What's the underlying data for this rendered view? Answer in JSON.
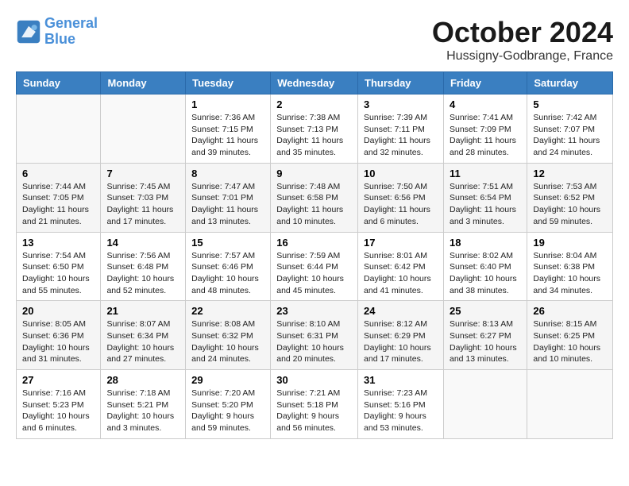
{
  "header": {
    "logo_line1": "General",
    "logo_line2": "Blue",
    "month": "October 2024",
    "location": "Hussigny-Godbrange, France"
  },
  "weekdays": [
    "Sunday",
    "Monday",
    "Tuesday",
    "Wednesday",
    "Thursday",
    "Friday",
    "Saturday"
  ],
  "weeks": [
    [
      {
        "day": "",
        "info": ""
      },
      {
        "day": "",
        "info": ""
      },
      {
        "day": "1",
        "info": "Sunrise: 7:36 AM\nSunset: 7:15 PM\nDaylight: 11 hours and 39 minutes."
      },
      {
        "day": "2",
        "info": "Sunrise: 7:38 AM\nSunset: 7:13 PM\nDaylight: 11 hours and 35 minutes."
      },
      {
        "day": "3",
        "info": "Sunrise: 7:39 AM\nSunset: 7:11 PM\nDaylight: 11 hours and 32 minutes."
      },
      {
        "day": "4",
        "info": "Sunrise: 7:41 AM\nSunset: 7:09 PM\nDaylight: 11 hours and 28 minutes."
      },
      {
        "day": "5",
        "info": "Sunrise: 7:42 AM\nSunset: 7:07 PM\nDaylight: 11 hours and 24 minutes."
      }
    ],
    [
      {
        "day": "6",
        "info": "Sunrise: 7:44 AM\nSunset: 7:05 PM\nDaylight: 11 hours and 21 minutes."
      },
      {
        "day": "7",
        "info": "Sunrise: 7:45 AM\nSunset: 7:03 PM\nDaylight: 11 hours and 17 minutes."
      },
      {
        "day": "8",
        "info": "Sunrise: 7:47 AM\nSunset: 7:01 PM\nDaylight: 11 hours and 13 minutes."
      },
      {
        "day": "9",
        "info": "Sunrise: 7:48 AM\nSunset: 6:58 PM\nDaylight: 11 hours and 10 minutes."
      },
      {
        "day": "10",
        "info": "Sunrise: 7:50 AM\nSunset: 6:56 PM\nDaylight: 11 hours and 6 minutes."
      },
      {
        "day": "11",
        "info": "Sunrise: 7:51 AM\nSunset: 6:54 PM\nDaylight: 11 hours and 3 minutes."
      },
      {
        "day": "12",
        "info": "Sunrise: 7:53 AM\nSunset: 6:52 PM\nDaylight: 10 hours and 59 minutes."
      }
    ],
    [
      {
        "day": "13",
        "info": "Sunrise: 7:54 AM\nSunset: 6:50 PM\nDaylight: 10 hours and 55 minutes."
      },
      {
        "day": "14",
        "info": "Sunrise: 7:56 AM\nSunset: 6:48 PM\nDaylight: 10 hours and 52 minutes."
      },
      {
        "day": "15",
        "info": "Sunrise: 7:57 AM\nSunset: 6:46 PM\nDaylight: 10 hours and 48 minutes."
      },
      {
        "day": "16",
        "info": "Sunrise: 7:59 AM\nSunset: 6:44 PM\nDaylight: 10 hours and 45 minutes."
      },
      {
        "day": "17",
        "info": "Sunrise: 8:01 AM\nSunset: 6:42 PM\nDaylight: 10 hours and 41 minutes."
      },
      {
        "day": "18",
        "info": "Sunrise: 8:02 AM\nSunset: 6:40 PM\nDaylight: 10 hours and 38 minutes."
      },
      {
        "day": "19",
        "info": "Sunrise: 8:04 AM\nSunset: 6:38 PM\nDaylight: 10 hours and 34 minutes."
      }
    ],
    [
      {
        "day": "20",
        "info": "Sunrise: 8:05 AM\nSunset: 6:36 PM\nDaylight: 10 hours and 31 minutes."
      },
      {
        "day": "21",
        "info": "Sunrise: 8:07 AM\nSunset: 6:34 PM\nDaylight: 10 hours and 27 minutes."
      },
      {
        "day": "22",
        "info": "Sunrise: 8:08 AM\nSunset: 6:32 PM\nDaylight: 10 hours and 24 minutes."
      },
      {
        "day": "23",
        "info": "Sunrise: 8:10 AM\nSunset: 6:31 PM\nDaylight: 10 hours and 20 minutes."
      },
      {
        "day": "24",
        "info": "Sunrise: 8:12 AM\nSunset: 6:29 PM\nDaylight: 10 hours and 17 minutes."
      },
      {
        "day": "25",
        "info": "Sunrise: 8:13 AM\nSunset: 6:27 PM\nDaylight: 10 hours and 13 minutes."
      },
      {
        "day": "26",
        "info": "Sunrise: 8:15 AM\nSunset: 6:25 PM\nDaylight: 10 hours and 10 minutes."
      }
    ],
    [
      {
        "day": "27",
        "info": "Sunrise: 7:16 AM\nSunset: 5:23 PM\nDaylight: 10 hours and 6 minutes."
      },
      {
        "day": "28",
        "info": "Sunrise: 7:18 AM\nSunset: 5:21 PM\nDaylight: 10 hours and 3 minutes."
      },
      {
        "day": "29",
        "info": "Sunrise: 7:20 AM\nSunset: 5:20 PM\nDaylight: 9 hours and 59 minutes."
      },
      {
        "day": "30",
        "info": "Sunrise: 7:21 AM\nSunset: 5:18 PM\nDaylight: 9 hours and 56 minutes."
      },
      {
        "day": "31",
        "info": "Sunrise: 7:23 AM\nSunset: 5:16 PM\nDaylight: 9 hours and 53 minutes."
      },
      {
        "day": "",
        "info": ""
      },
      {
        "day": "",
        "info": ""
      }
    ]
  ]
}
